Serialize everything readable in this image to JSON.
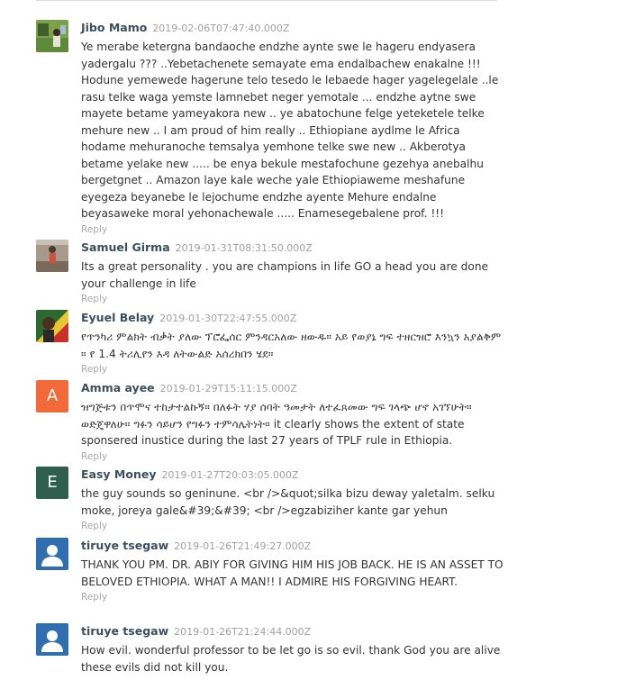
{
  "colors": {
    "author": "#3c4f5f",
    "timestamp": "#a0a0a0",
    "reply": "#a8a8a8",
    "avatar_amma": "#f26a3a",
    "avatar_easy": "#2f5f4f",
    "avatar_default": "#2f6fb0"
  },
  "comments": [
    {
      "author": "Jibo Mamo",
      "time": "2019-02-06T07:47:40.000Z",
      "avatar_icon": "photo-avatar-icon",
      "text": "Ye merabe ketergna bandaoche   endzhe aynte swe le hageru endyasera yadergalu ??? ..Yebetachenete semayate ema endalbachew enakalne !!! Hodune yemewede hagerune telo tesedo le lebaede hager yagelegelale ..le rasu telke waga yemste lamnebet neger yemotale ... endzhe aytne swe mayete betame yameyakora new .. ye abatochune felge yeteketele telke mehure new .. I am proud of him really .. Ethiopiane aydlme le Africa hodame mehuranoche temsalya yemhone telke swe new .. Akberotya betame yelake new ..... be enya bekule mestafochune gezehya anebalhu bergetgnet .. Amazon laye kale weche yale Ethiopiaweme meshafune eyegeza beyanebe le lejochume endzhe ayente Mehure endalne beyasaweke moral yehonachewale ..... Enamesegebalene prof. !!!",
      "reply": "Reply"
    },
    {
      "author": "Samuel Girma",
      "time": "2019-01-31T08:31:50.000Z",
      "avatar_icon": "photo-avatar-icon",
      "text": "Its a great personality . you are champions in life GO a head you are done your challenge in life",
      "reply": "Reply"
    },
    {
      "author": "Eyuel Belay",
      "time": "2019-01-30T22:47:55.000Z",
      "avatar_icon": "photo-avatar-icon",
      "text": "የጥንካሪ ምልክት ብቃት ያለው ፕሮፌሰር ምንዳርአለው ዘውዱ። አይ የወያኔ ግፍ ተዘርዝሮ እንኳን አያልቅም ። የ 1.4 ትሪሊየን እዳ ለትውልድ አሰረክበን ሄደ።",
      "reply": "Reply"
    },
    {
      "author": "Amma ayee",
      "time": "2019-01-29T15:11:15.000Z",
      "avatar_letter": "A",
      "text": "ዝግጅቱን በጥሞና ተከታተልኩኝ። በለፉት ሃያ ሰባት ዓመታት ለተፈጸመው ግፍ ገላጭ ሆኖ አገኘሁት። ወድጄዋለሁ። ግፉን ሳይሆን የግፉን ተምሳሌትነት። it clearly shows the extent of state sponsered inustice during the last 27 years of TPLF rule in Ethiopia.",
      "reply": "Reply"
    },
    {
      "author": "Easy Money",
      "time": "2019-01-27T20:03:05.000Z",
      "avatar_letter": "E",
      "text": "the guy sounds so geninune. <br />&quot;silka bizu deway yaletalm. selku moke, joreya gale&#39;&#39; <br />egzabiziher kante gar yehun",
      "reply": "Reply"
    },
    {
      "author": "tiruye tsegaw",
      "time": "2019-01-26T21:49:27.000Z",
      "avatar_icon": "default-user-icon",
      "text": "THANK YOU PM. DR. ABIY FOR GIVING HIM HIS JOB BACK. HE IS AN ASSET TO BELOVED ETHIOPIA. WHAT A MAN!! I ADMIRE HIS FORGIVING HEART.",
      "reply": "Reply"
    },
    {
      "author": "tiruye tsegaw",
      "time": "2019-01-26T21:24:44.000Z",
      "avatar_icon": "default-user-icon",
      "text": "How evil. wonderful professor to be let go is so evil. thank God you are alive these evils did not kill you.",
      "reply": "Reply"
    }
  ]
}
